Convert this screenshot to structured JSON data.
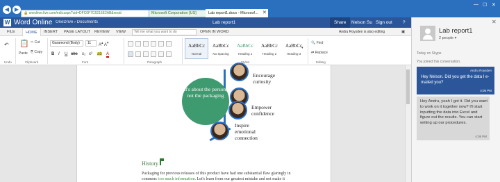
{
  "browser": {
    "url": "onedrive.live.com/edit.aspx?cid=DFC0F7C6216E2AB&resid",
    "cert_label": "Microsoft Corporation [US]",
    "tab_title": "Lab report1.docx - Microsof..."
  },
  "word_bar": {
    "app_name": "Word Online",
    "breadcrumb": "OneDrive  ›  Documents",
    "doc_name": "Lab report1",
    "share": "Share",
    "user": "Nelson Su",
    "sign_out": "Sign out",
    "help": "?"
  },
  "ribbon_tabs": {
    "tabs": [
      "FILE",
      "HOME",
      "INSERT",
      "PAGE LAYOUT",
      "REVIEW",
      "VIEW"
    ],
    "tell_me": "Tell me what you want to do",
    "open_in_word": "OPEN IN WORD",
    "editing_notice": "Andru Roysden is also editing"
  },
  "ribbon": {
    "undo_label": "Undo",
    "paste": "Paste",
    "cut": "Cut",
    "copy": "Copy",
    "clipboard_label": "Clipboard",
    "font_name": "Garamond (Body)",
    "font_size": "11",
    "font_label": "Font",
    "paragraph_label": "Paragraph",
    "styles_label": "Styles",
    "editing_label": "Editing",
    "find": "Find",
    "replace": "Replace",
    "styles": [
      {
        "sample": "AaBbCc",
        "name": "Normal"
      },
      {
        "sample": "AaBbCc",
        "name": "No Spacing"
      },
      {
        "sample": "AaBbCc",
        "name": "Heading 1"
      },
      {
        "sample": "AaBbCc",
        "name": "Heading 2"
      },
      {
        "sample": "AaBbCc",
        "name": "Heading 3"
      }
    ]
  },
  "document": {
    "center_text": "It's about the person, not the packaging",
    "labels": [
      "Encourage curiosity",
      "Empower confidence",
      "Inspire emotional connection"
    ],
    "history_heading": "History",
    "body_line1": "Packaging for previous releases of this product have had one substantial flaw glaringly in",
    "body_line2_a": "common: ",
    "body_line2_b": "too much information",
    "body_line2_c": ". Let's learn from our greatest mistake and not make it"
  },
  "chat": {
    "title": "Lab report1",
    "people": "2 people ▾",
    "skype_meta": "Today on Skype",
    "joined": "You joined this conversation.",
    "msg1_from": "Andru Roysden",
    "msg1_text": "Hey Nelson. Did you get the data I e-mailed you?",
    "msg1_time": "4:05 PM",
    "msg2_text": "Hey Andru, yeah I got it. Did you want to work on it together now? I'll start inputting the data into Excel and figure out the results. You can start writing up our procedures.",
    "msg2_time": "4:08 PM"
  }
}
